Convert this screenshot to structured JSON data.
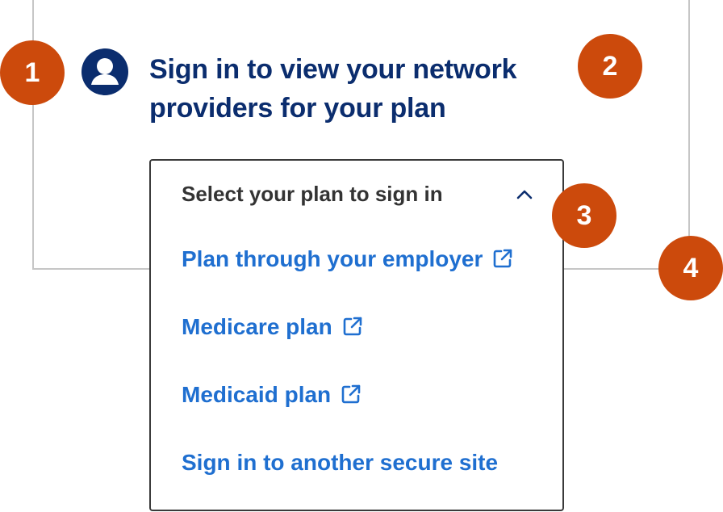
{
  "header": {
    "icon": "user-account-icon",
    "title": "Sign in to view your network providers for your plan"
  },
  "dropdown": {
    "label": "Select your plan to sign in",
    "expanded": true,
    "chevron_icon": "chevron-up-icon",
    "options": [
      {
        "label": "Plan through your employer",
        "external": true,
        "icon": "external-link-icon"
      },
      {
        "label": "Medicare plan",
        "external": true,
        "icon": "external-link-icon"
      },
      {
        "label": "Medicaid plan",
        "external": true,
        "icon": "external-link-icon"
      },
      {
        "label": "Sign in to another secure site",
        "external": false
      }
    ]
  },
  "markers": [
    "1",
    "2",
    "3",
    "4"
  ],
  "colors": {
    "title": "#0b2d6e",
    "link": "#1f6fd0",
    "marker": "#cc4a0c",
    "dropdown_border": "#3a3a3a",
    "card_border": "#c6c6c6"
  }
}
